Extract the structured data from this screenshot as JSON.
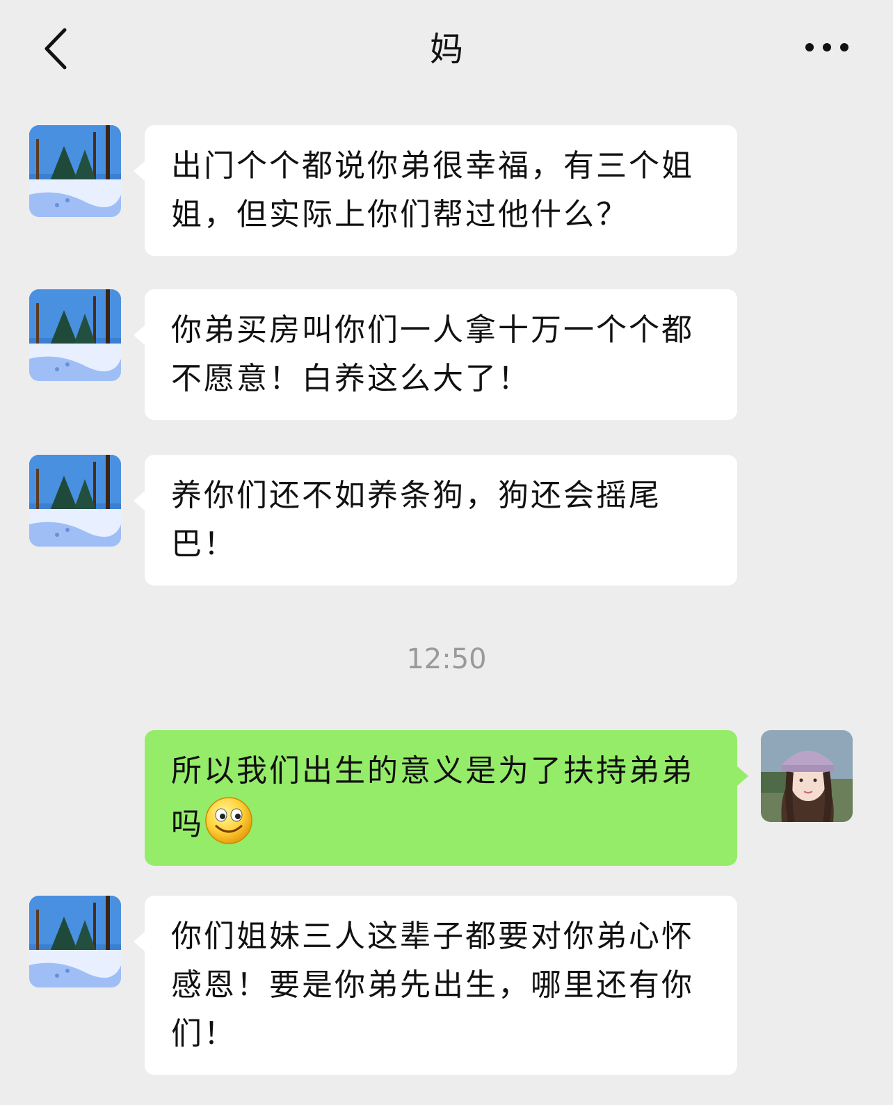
{
  "header": {
    "title": "妈"
  },
  "messages": [
    {
      "sender": "mom",
      "text": "出门个个都说你弟很幸福，有三个姐姐，但实际上你们帮过他什么？"
    },
    {
      "sender": "mom",
      "text": "你弟买房叫你们一人拿十万一个个都不愿意！白养这么大了！"
    },
    {
      "sender": "mom",
      "text": "养你们还不如养条狗，狗还会摇尾巴！"
    },
    {
      "sender": "me",
      "text": "所以我们出生的意义是为了扶持弟弟吗",
      "emoji": "smile-emoji"
    },
    {
      "sender": "mom",
      "text": "你们姐妹三人这辈子都要对你弟心怀感恩！要是你弟先出生，哪里还有你们！"
    }
  ],
  "timestamp": "12:50",
  "colors": {
    "background": "#ededed",
    "incoming_bubble": "#ffffff",
    "outgoing_bubble": "#95ec69",
    "timestamp": "#9a9a9a"
  },
  "icons": {
    "back": "chevron-left-icon",
    "more": "more-dots-icon"
  }
}
